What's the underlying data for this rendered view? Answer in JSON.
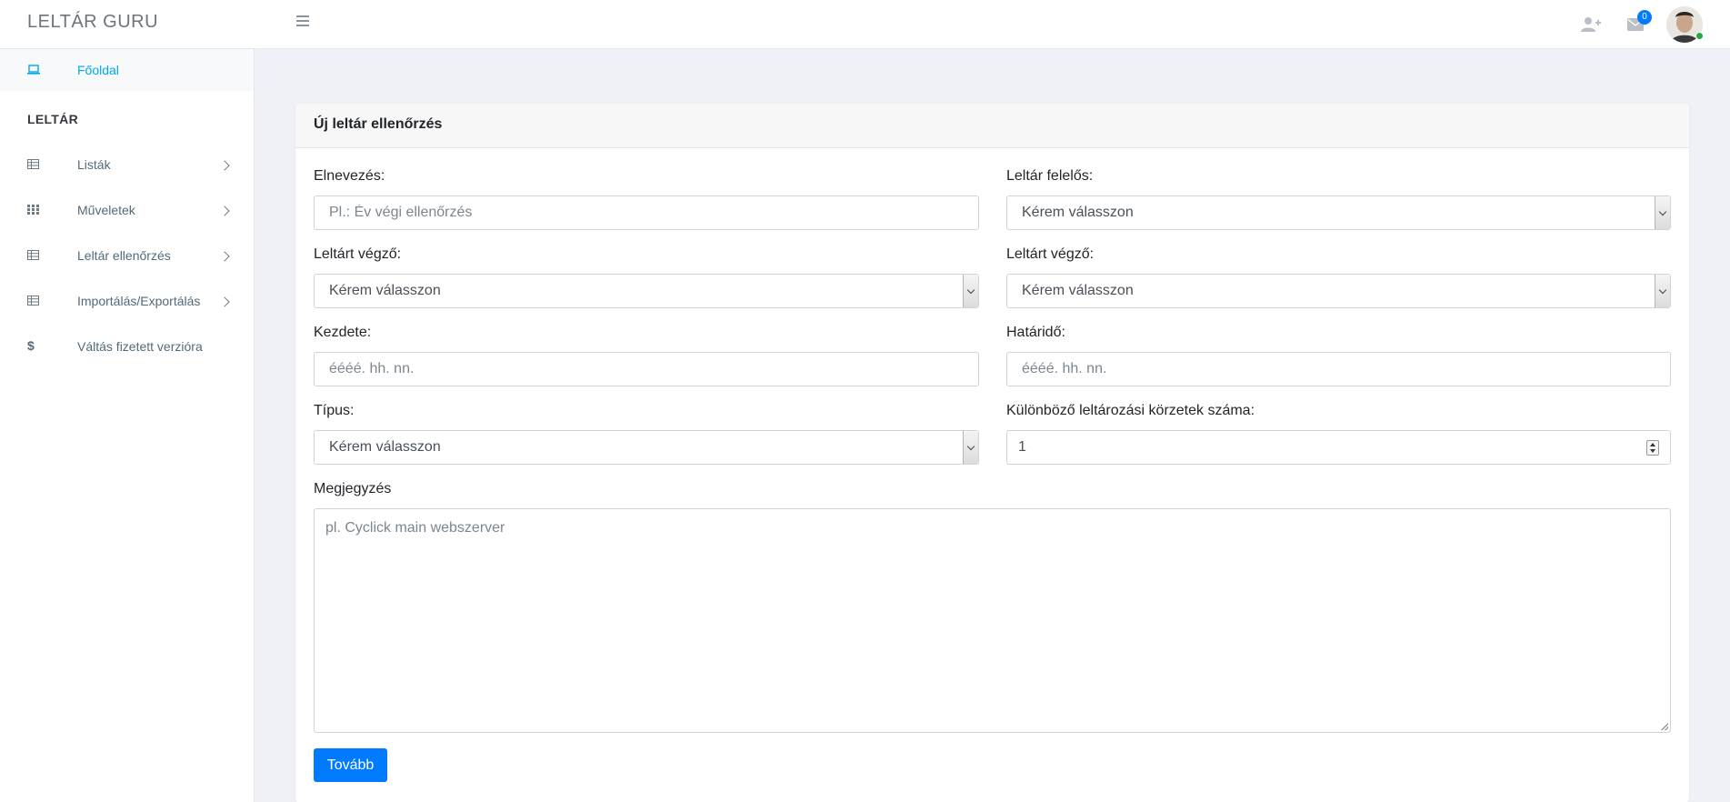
{
  "header": {
    "brand": "LELTÁR GURU",
    "mail_count": "0"
  },
  "sidebar": {
    "home_label": "Főoldal",
    "section_title": "LELTÁR",
    "items": [
      {
        "label": "Listák",
        "icon": "table-icon"
      },
      {
        "label": "Műveletek",
        "icon": "grid-icon"
      },
      {
        "label": "Leltár ellenőrzés",
        "icon": "table-icon"
      },
      {
        "label": "Importálás/Exportálás",
        "icon": "table-icon"
      },
      {
        "label": "Váltás fizetett verzióra",
        "icon": "dollar-icon"
      }
    ]
  },
  "form": {
    "title": "Új leltár ellenőrzés",
    "name_label": "Elnevezés:",
    "name_placeholder": "Pl.: Év végi ellenőrzés",
    "responsible_label": "Leltár felelős:",
    "responsible_value": "Kérem válasszon",
    "performer1_label": "Leltárt végző:",
    "performer1_value": "Kérem válasszon",
    "performer2_label": "Leltárt végző:",
    "performer2_value": "Kérem válasszon",
    "start_label": "Kezdete:",
    "start_placeholder": "éééé. hh. nn.",
    "deadline_label": "Határidő:",
    "deadline_placeholder": "éééé. hh. nn.",
    "type_label": "Típus:",
    "type_value": "Kérem válasszon",
    "zones_label": "Különböző leltározási körzetek száma:",
    "zones_value": "1",
    "note_label": "Megjegyzés",
    "note_placeholder": "pl. Cyclick main webszerver",
    "submit_label": "Tovább"
  },
  "colors": {
    "accent": "#007bff",
    "home_link": "#00a8e8",
    "background": "#f0f1f6"
  }
}
